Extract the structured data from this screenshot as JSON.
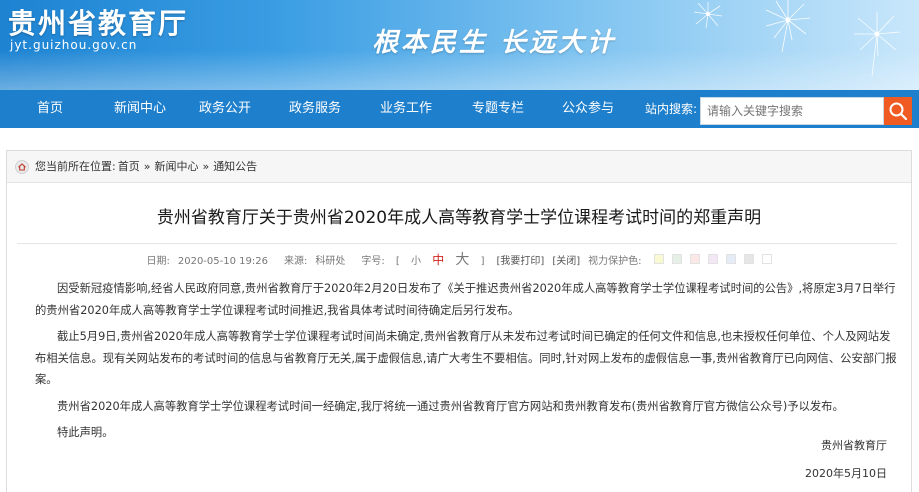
{
  "header": {
    "site_name": "贵州省教育厅",
    "site_url": "jyt.guizhou.gov.cn",
    "slogan": "根本民生 长远大计"
  },
  "nav": {
    "items": [
      {
        "label": "首页"
      },
      {
        "label": "新闻中心"
      },
      {
        "label": "政务公开"
      },
      {
        "label": "政务服务"
      },
      {
        "label": "业务工作"
      },
      {
        "label": "专题专栏"
      },
      {
        "label": "公众参与"
      }
    ],
    "search_label": "站内搜索:",
    "search_placeholder": "请输入关键字搜索",
    "search_icon": "search-icon"
  },
  "breadcrumb": {
    "prefix": "您当前所在位置:",
    "items": [
      "首页",
      "新闻中心",
      "通知公告"
    ],
    "separator": "»",
    "icon": "home-icon"
  },
  "article": {
    "title": "贵州省教育厅关于贵州省2020年成人高等教育学士学位课程考试时间的郑重声明",
    "date_label": "日期:",
    "date": "2020-05-10 19:26",
    "source_label": "来源:",
    "source": "科研处",
    "font_label": "字号:",
    "font_open": "[",
    "font_small": "小",
    "font_mid": "中",
    "font_large": "大",
    "font_close": "]",
    "print_btn": "[我要打印]",
    "close_btn": "[关闭]",
    "eye_label": "视力保护色:",
    "eye_colors": [
      "#fafad2",
      "#e6f0e6",
      "#fde8e8",
      "#f3e6f5",
      "#e6ecf7",
      "#e6e6e6",
      "#ffffff"
    ],
    "paragraphs": [
      "因受新冠疫情影响,经省人民政府同意,贵州省教育厅于2020年2月20日发布了《关于推迟贵州省2020年成人高等教育学士学位课程考试时间的公告》,将原定3月7日举行的贵州省2020年成人高等教育学士学位课程考试时间推迟,我省具体考试时间待确定后另行发布。",
      "截止5月9日,贵州省2020年成人高等教育学士学位课程考试时间尚未确定,贵州省教育厅从未发布过考试时间已确定的任何文件和信息,也未授权任何单位、个人及网站发布相关信息。现有关网站发布的考试时间的信息与省教育厅无关,属于虚假信息,请广大考生不要相信。同时,针对网上发布的虚假信息一事,贵州省教育厅已向网信、公安部门报案。",
      "贵州省2020年成人高等教育学士学位课程考试时间一经确定,我厅将统一通过贵州省教育厅官方网站和贵州教育发布(贵州省教育厅官方微信公众号)予以发布。",
      "特此声明。"
    ],
    "signature": "贵州省教育厅",
    "sign_date": "2020年5月10日"
  },
  "colors": {
    "nav_bg": "#1e7fcc",
    "search_button": "#f05a23",
    "font_mid_active": "#d0261d"
  }
}
